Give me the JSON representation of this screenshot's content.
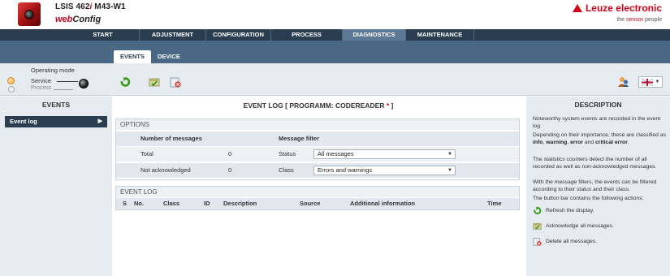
{
  "header": {
    "device_name_prefix": "LSIS 462",
    "device_name_italic": "i",
    "device_name_suffix": " M43-W1",
    "app_name_web": "web",
    "app_name_config": "Config",
    "brand": "Leuze electronic",
    "slogan_prefix": "the ",
    "slogan_highlight": "sensor",
    "slogan_suffix": " people"
  },
  "topnav": {
    "tabs": [
      {
        "label": "START"
      },
      {
        "label": "ADJUSTMENT"
      },
      {
        "label": "CONFIGURATION"
      },
      {
        "label": "PROCESS"
      },
      {
        "label": "DIAGNOSTICS",
        "active": true
      },
      {
        "label": "MAINTENANCE"
      }
    ]
  },
  "subtabs": [
    {
      "label": "EVENTS",
      "active": true
    },
    {
      "label": "DEVICE"
    }
  ],
  "operating_mode": {
    "title": "Operating mode",
    "service": "Service",
    "process": "Process"
  },
  "toolbar": {
    "refresh_icon": "refresh-icon",
    "acknowledge_icon": "acknowledge-icon",
    "delete_icon": "delete-icon",
    "user_icon": "user-icon",
    "language_icon": "language-flag-icon"
  },
  "sidebar": {
    "title": "EVENTS",
    "items": [
      {
        "label": "Event log",
        "active": true
      }
    ]
  },
  "main": {
    "title_prefix": "EVENT LOG   [ PROGRAMM: CODEREADER ",
    "title_star": "*",
    "title_suffix": " ]",
    "options": {
      "title": "OPTIONS",
      "col_messages": "Number of messages",
      "col_filter": "Message filter",
      "total_label": "Total",
      "total_value": "0",
      "unack_label": "Not acknowledged",
      "unack_value": "0",
      "status_label": "Status",
      "status_value": "All messages",
      "class_label": "Class",
      "class_value": "Errors and warnings"
    },
    "event_log": {
      "title": "EVENT LOG",
      "columns": [
        "S",
        "No.",
        "Class",
        "ID",
        "Description",
        "Source",
        "Additional information",
        "Time"
      ]
    }
  },
  "description": {
    "title": "DESCRIPTION",
    "p1": "Noteworthy system events are recorded in the event log.",
    "p2_a": "Depending on their importance, these are classified as ",
    "p2_info": "info",
    "p2_b": ", ",
    "p2_warning": "warning",
    "p2_c": ", ",
    "p2_error": "error",
    "p2_d": " and ",
    "p2_critical": "critical error",
    "p2_e": ".",
    "p3": "The statistics counters detect the number of all recorded as well as non-acknowledged messages.",
    "p4": "With the message filters, the events can be filtered according to their status and their class.",
    "p5": "The button bar contains the following actions:",
    "actions": [
      {
        "icon": "refresh-icon",
        "label": "Refresh the display."
      },
      {
        "icon": "acknowledge-icon",
        "label": "Acknowledge all messages."
      },
      {
        "icon": "delete-icon",
        "label": "Delete all messages."
      }
    ]
  },
  "colors": {
    "nav_dark": "#2b3e51",
    "band_blue": "#4a6784",
    "brand_red": "#d0021b",
    "panel_bg": "#e6ebf0"
  }
}
